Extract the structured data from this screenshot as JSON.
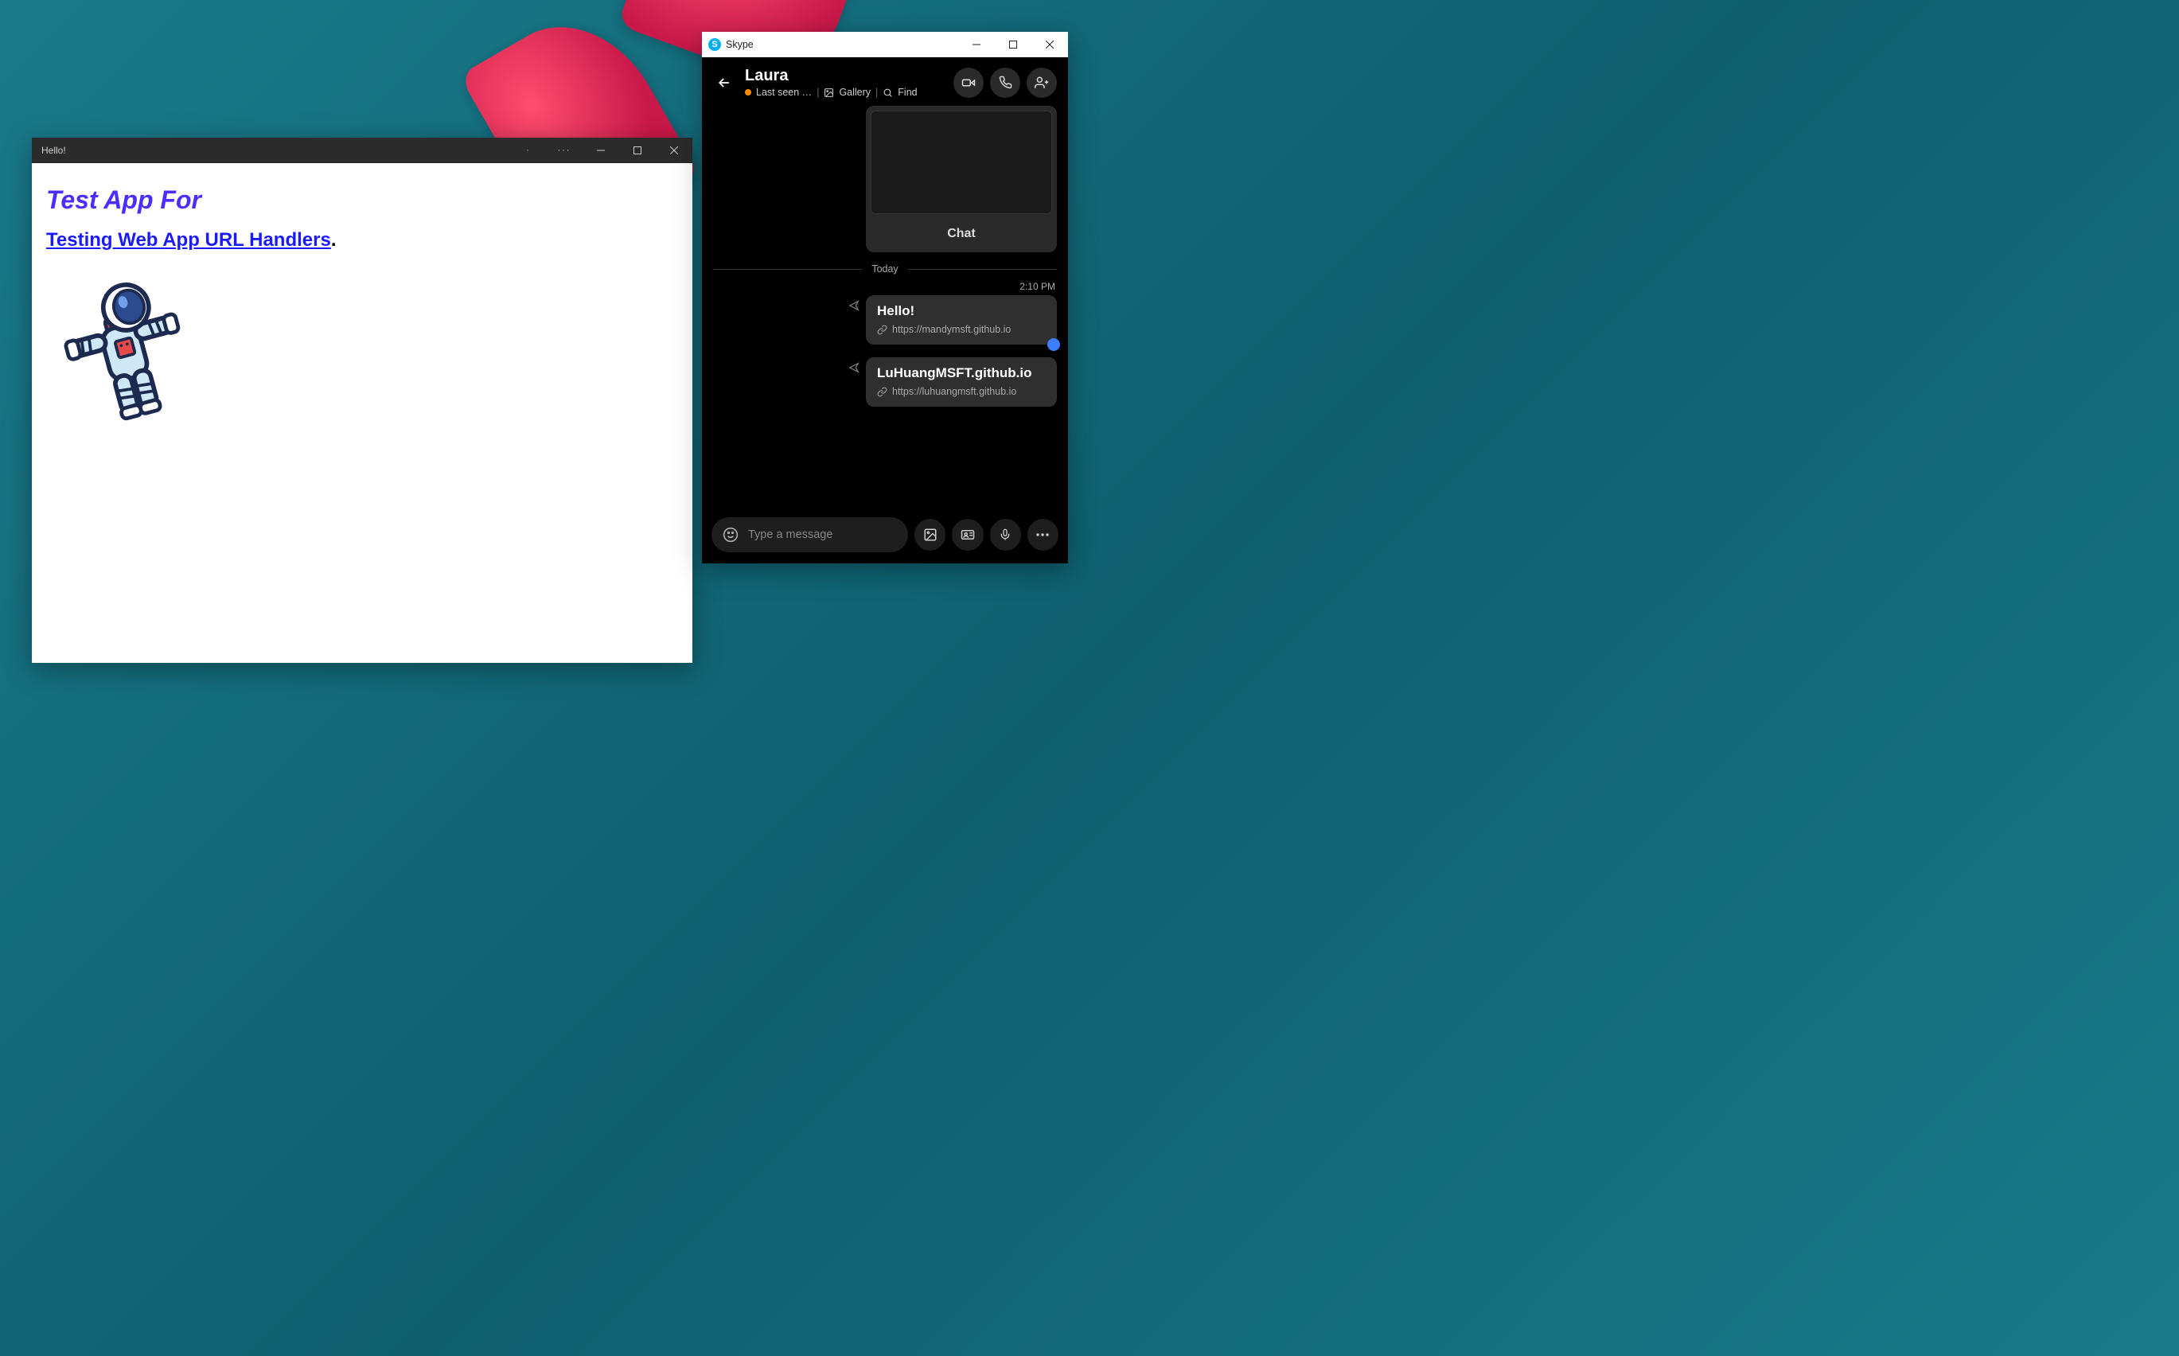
{
  "pwa": {
    "title": "Hello!",
    "heading": "Test App For",
    "link_text": "Testing Web App URL Handlers",
    "dot": "."
  },
  "skype": {
    "app_name": "Skype",
    "contact": {
      "name": "Laura",
      "last_seen": "Last seen …",
      "gallery": "Gallery",
      "find": "Find"
    },
    "preview_card_label": "Chat",
    "date_divider": "Today",
    "timestamp": "2:10 PM",
    "messages": [
      {
        "title": "Hello!",
        "url": "https://mandymsft.github.io"
      },
      {
        "title": "LuHuangMSFT.github.io",
        "url": "https://luhuangmsft.github.io"
      }
    ],
    "input_placeholder": "Type a message"
  }
}
